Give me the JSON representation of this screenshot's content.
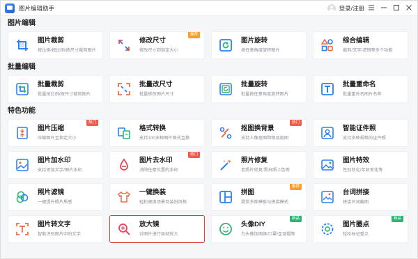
{
  "app": {
    "title": "图片编辑助手",
    "login": "登录/注册"
  },
  "colors": {
    "accent": "#2b7fff",
    "hot": "#f25a4a",
    "recommend": "#ff9b2f",
    "new": "#2bb673",
    "selected_border": "#e03b3b"
  },
  "sections": [
    {
      "title": "图片编辑",
      "items": [
        {
          "title": "图片裁剪",
          "desc": "按比例/按比例/按尺寸裁剪图片",
          "icon": "crop-icon",
          "badge": ""
        },
        {
          "title": "修改尺寸",
          "desc": "修改尺寸到指定大小",
          "icon": "resize-arrows-icon",
          "badge": "推荐"
        },
        {
          "title": "图片旋转",
          "desc": "按任意角度旋转图片",
          "icon": "rotate-icon",
          "badge": ""
        },
        {
          "title": "综合编辑",
          "desc": "裁剪/文字/滤镜等多个功能",
          "icon": "shapes-icon",
          "badge": ""
        }
      ]
    },
    {
      "title": "批量编辑",
      "items": [
        {
          "title": "批量裁剪",
          "desc": "批量按比例/按尺寸裁剪图片",
          "icon": "batch-crop-icon",
          "badge": ""
        },
        {
          "title": "批量改尺寸",
          "desc": "批量修改图片尺寸",
          "icon": "batch-resize-icon",
          "badge": ""
        },
        {
          "title": "批量旋转",
          "desc": "批量按任意角度旋转图片",
          "icon": "batch-rotate-icon",
          "badge": ""
        },
        {
          "title": "批量重命名",
          "desc": "批量重命名图片名称",
          "icon": "rename-icon",
          "badge": ""
        }
      ]
    },
    {
      "title": "特色功能",
      "items": [
        {
          "title": "图片压缩",
          "desc": "压缩图片至指定大小",
          "icon": "compress-icon",
          "badge": "热门"
        },
        {
          "title": "格式转换",
          "desc": "支持100多种图片格式互换",
          "icon": "convert-icon",
          "badge": ""
        },
        {
          "title": "抠图换背景",
          "desc": "支持人像抠图和物品抠图",
          "icon": "cutout-icon",
          "badge": "热门"
        },
        {
          "title": "智能证件照",
          "desc": "支持多种规格的证件照",
          "icon": "id-photo-icon",
          "badge": ""
        },
        {
          "title": "图片加水印",
          "desc": "支持添加文字/图片水印",
          "icon": "add-watermark-icon",
          "badge": ""
        },
        {
          "title": "图片去水印",
          "desc": "消除任意位置的水印",
          "icon": "remove-watermark-icon",
          "badge": "热门"
        },
        {
          "title": "照片修复",
          "desc": "老照片修复/黑白照上色等",
          "icon": "magic-wand-icon",
          "badge": ""
        },
        {
          "title": "图片特效",
          "desc": "性别变化/年龄变化等",
          "icon": "picture-effect-icon",
          "badge": ""
        },
        {
          "title": "照片滤镜",
          "desc": "一键提升照片质感",
          "icon": "filter-icon",
          "badge": ""
        },
        {
          "title": "一键换装",
          "desc": "轻松更换场景及装扮风格",
          "icon": "tshirt-icon",
          "badge": ""
        },
        {
          "title": "拼图",
          "desc": "提供多种模板与拼接模式",
          "icon": "collage-icon",
          "badge": "推荐"
        },
        {
          "title": "台词拼接",
          "desc": "拼接台词截图",
          "icon": "subtitle-icon",
          "badge": ""
        },
        {
          "title": "图片转文字",
          "desc": "智能识别图片中的文字",
          "icon": "ocr-icon",
          "badge": ""
        },
        {
          "title": "放大镜",
          "desc": "对图片进行局部放大",
          "icon": "magnifier-icon",
          "badge": ""
        },
        {
          "title": "头像DIY",
          "desc": "为头像加国旗/口罩/圣诞帽等",
          "icon": "smiley-icon",
          "badge": "新品"
        },
        {
          "title": "图片圈点",
          "desc": "轻松标记重点",
          "icon": "circle-mark-icon",
          "badge": "新品"
        }
      ]
    }
  ]
}
